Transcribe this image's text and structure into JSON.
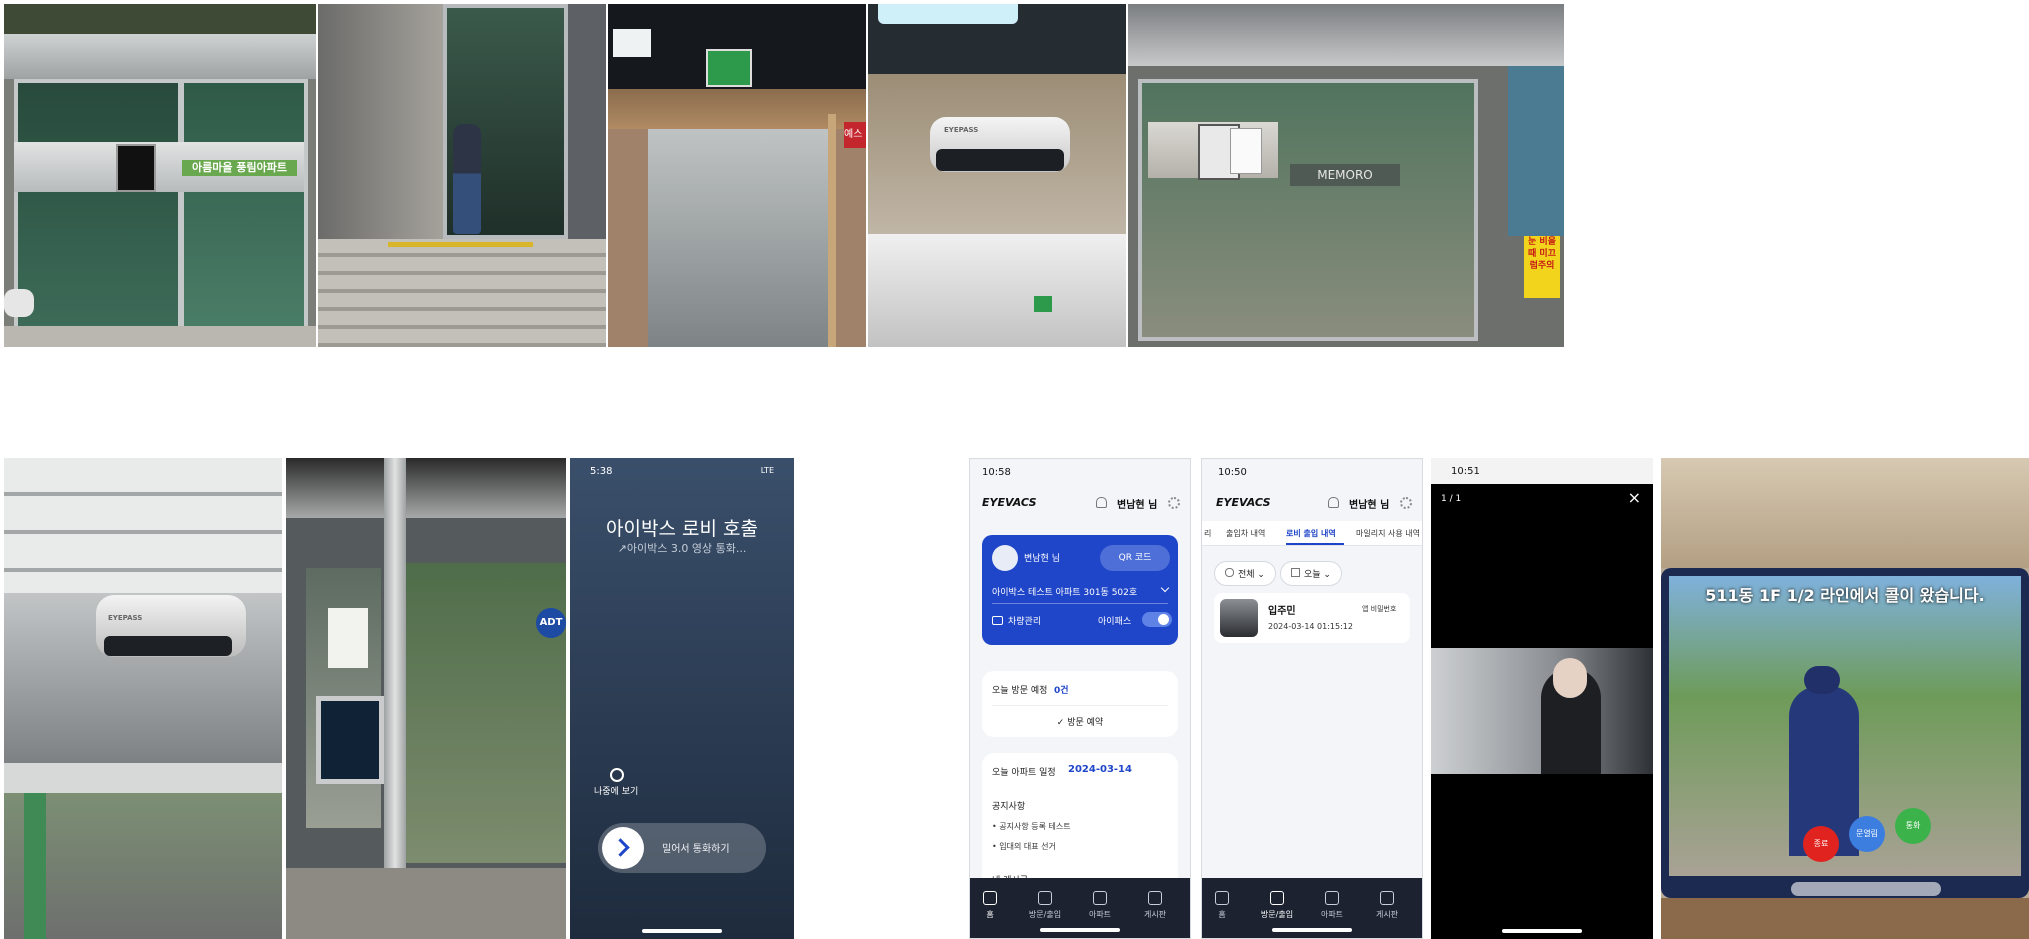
{
  "photos": {
    "entrance_sign": "아름마을 풍림아파트",
    "memoro_sign": "MEMORO",
    "exit_sign_partial": "예스",
    "device_brand": "EYEPASS",
    "device_brand_2": "EYEPASS",
    "adt_badge": "ADT",
    "warning_sign": "눈 비올때 미끄럼주의"
  },
  "call_screen": {
    "time": "5:38",
    "network": "LTE",
    "title": "아이박스 로비 호출",
    "subtitle": "↗아이박스 3.0 영상 통화...",
    "later_label": "나중에 보기",
    "slide_label": "밀어서 통화하기"
  },
  "home_screen": {
    "time": "10:58",
    "logo": "EYEVACS",
    "user": "변남현 님",
    "greeting": "변남현 님",
    "qr_label": "QR 코드",
    "address": "아이박스 테스트 아파트 301동 502호",
    "vehicle_label": "차량관리",
    "eyepass_label": "아이패스",
    "visit_title": "오늘 방문 예정",
    "visit_count": "0건",
    "visit_button": "✓ 방문 예약",
    "schedule_title": "오늘 아파트 일정",
    "schedule_date": "2024-03-14",
    "notice_title": "공지사항",
    "notice_items": [
      "• 공지사항 등록 테스트",
      "• 입대의 대표 선거"
    ],
    "more_partial": "내 게시글",
    "tabs": [
      "홈",
      "방문/출입",
      "아파트",
      "게시판"
    ]
  },
  "log_screen": {
    "time": "10:50",
    "logo": "EYEVACS",
    "user": "변남현 님",
    "tabs": [
      "리",
      "출입차 내역",
      "로비 출입 내역",
      "마일리지 사용 내역"
    ],
    "filter_all": "전체",
    "filter_today": "오늘",
    "entry_name": "입주민",
    "entry_method": "앱 비밀번호",
    "entry_time": "2024-03-14 01:15:12",
    "bottom_tabs": [
      "홈",
      "방문/출입",
      "아파트",
      "게시판"
    ]
  },
  "video_screen": {
    "time": "10:51",
    "counter": "1 / 1",
    "close": "×"
  },
  "tablet": {
    "banner": "511동 1F 1/2 라인에서 콜이 왔습니다.",
    "buttons": [
      "종료",
      "문열림",
      "통화"
    ]
  },
  "colors": {
    "app_blue": "#1f45c8",
    "tab_dark": "#1c2230",
    "accent_link": "#2a6fd6",
    "end_red": "#e0231f",
    "open_blue": "#3c7de0",
    "talk_green": "#3bb24a"
  }
}
